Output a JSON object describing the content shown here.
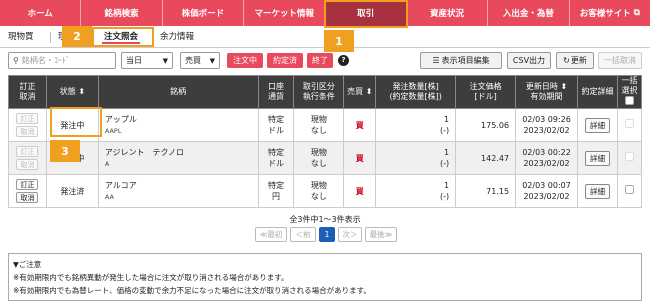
{
  "nav": [
    "ホーム",
    "銘柄検索",
    "株価ボード",
    "マーケット情報",
    "取引",
    "資産状況",
    "入出金・為替",
    "お客様サイト"
  ],
  "subtabs": [
    "現物買",
    "現",
    "注文照会",
    "余力情報"
  ],
  "toolbar": {
    "search_placeholder": "銘柄名・ｺｰﾄﾞ",
    "period": "当日",
    "side": "売買",
    "filters": [
      "注文中",
      "約定済",
      "終了"
    ],
    "help": "?",
    "display_settings": "表示項目編集",
    "csv": "CSV出力",
    "refresh": "更新",
    "bulk_cancel": "一括取消"
  },
  "headers": {
    "cancel": [
      "訂正",
      "取消"
    ],
    "status": "状態",
    "name": "銘柄",
    "account": [
      "口座",
      "通貨"
    ],
    "type": [
      "取引区分",
      "執行条件"
    ],
    "side": "売買",
    "qty": [
      "発注数量[株]",
      "(約定数量[株])"
    ],
    "price": [
      "注文価格",
      "[ドル]"
    ],
    "date": [
      "更新日時",
      "有効期間"
    ],
    "detail": "約定詳細",
    "bulk": "一括選択"
  },
  "rows": [
    {
      "status": "発注中",
      "name": "アップル",
      "ticker": "AAPL",
      "account": [
        "特定",
        "ドル"
      ],
      "type": [
        "現物",
        "なし"
      ],
      "side": "買",
      "qty": "1",
      "filled": "(-)",
      "price": "175.06",
      "date": [
        "02/03 09:26",
        "2023/02/02"
      ],
      "detail": "詳細",
      "edit": "訂正",
      "cancel": "取消"
    },
    {
      "status": "発注中",
      "name": "アジレント　テクノロ",
      "ticker": "A",
      "account": [
        "特定",
        "ドル"
      ],
      "type": [
        "現物",
        "なし"
      ],
      "side": "買",
      "qty": "1",
      "filled": "(-)",
      "price": "142.47",
      "date": [
        "02/03 00:22",
        "2023/02/02"
      ],
      "detail": "詳細",
      "edit": "訂正",
      "cancel": "取消"
    },
    {
      "status": "発注済",
      "name": "アルコア",
      "ticker": "AA",
      "account": [
        "特定",
        "円"
      ],
      "type": [
        "現物",
        "なし"
      ],
      "side": "買",
      "qty": "1",
      "filled": "(-)",
      "price": "71.15",
      "date": [
        "02/03 00:07",
        "2023/02/02"
      ],
      "detail": "詳細",
      "edit": "訂正",
      "cancel": "取消"
    }
  ],
  "pager": {
    "info": "全3件中1～3件表示",
    "first": "≪最初",
    "prev": "＜前",
    "page": "1",
    "next": "次＞",
    "last": "最後≫"
  },
  "notes": {
    "title": "▼ご注意",
    "lines": [
      "※有効期限内でも銘柄異動が発生した場合に注文が取り消される場合があります。",
      "※有効期限内でも為替レート、価格の変動で余力不足になった場合に注文が取り消される場合があります。"
    ]
  },
  "callouts": [
    "1",
    "2",
    "3"
  ],
  "colors": {
    "accent": "#e8495c",
    "callout": "#f0a020"
  }
}
